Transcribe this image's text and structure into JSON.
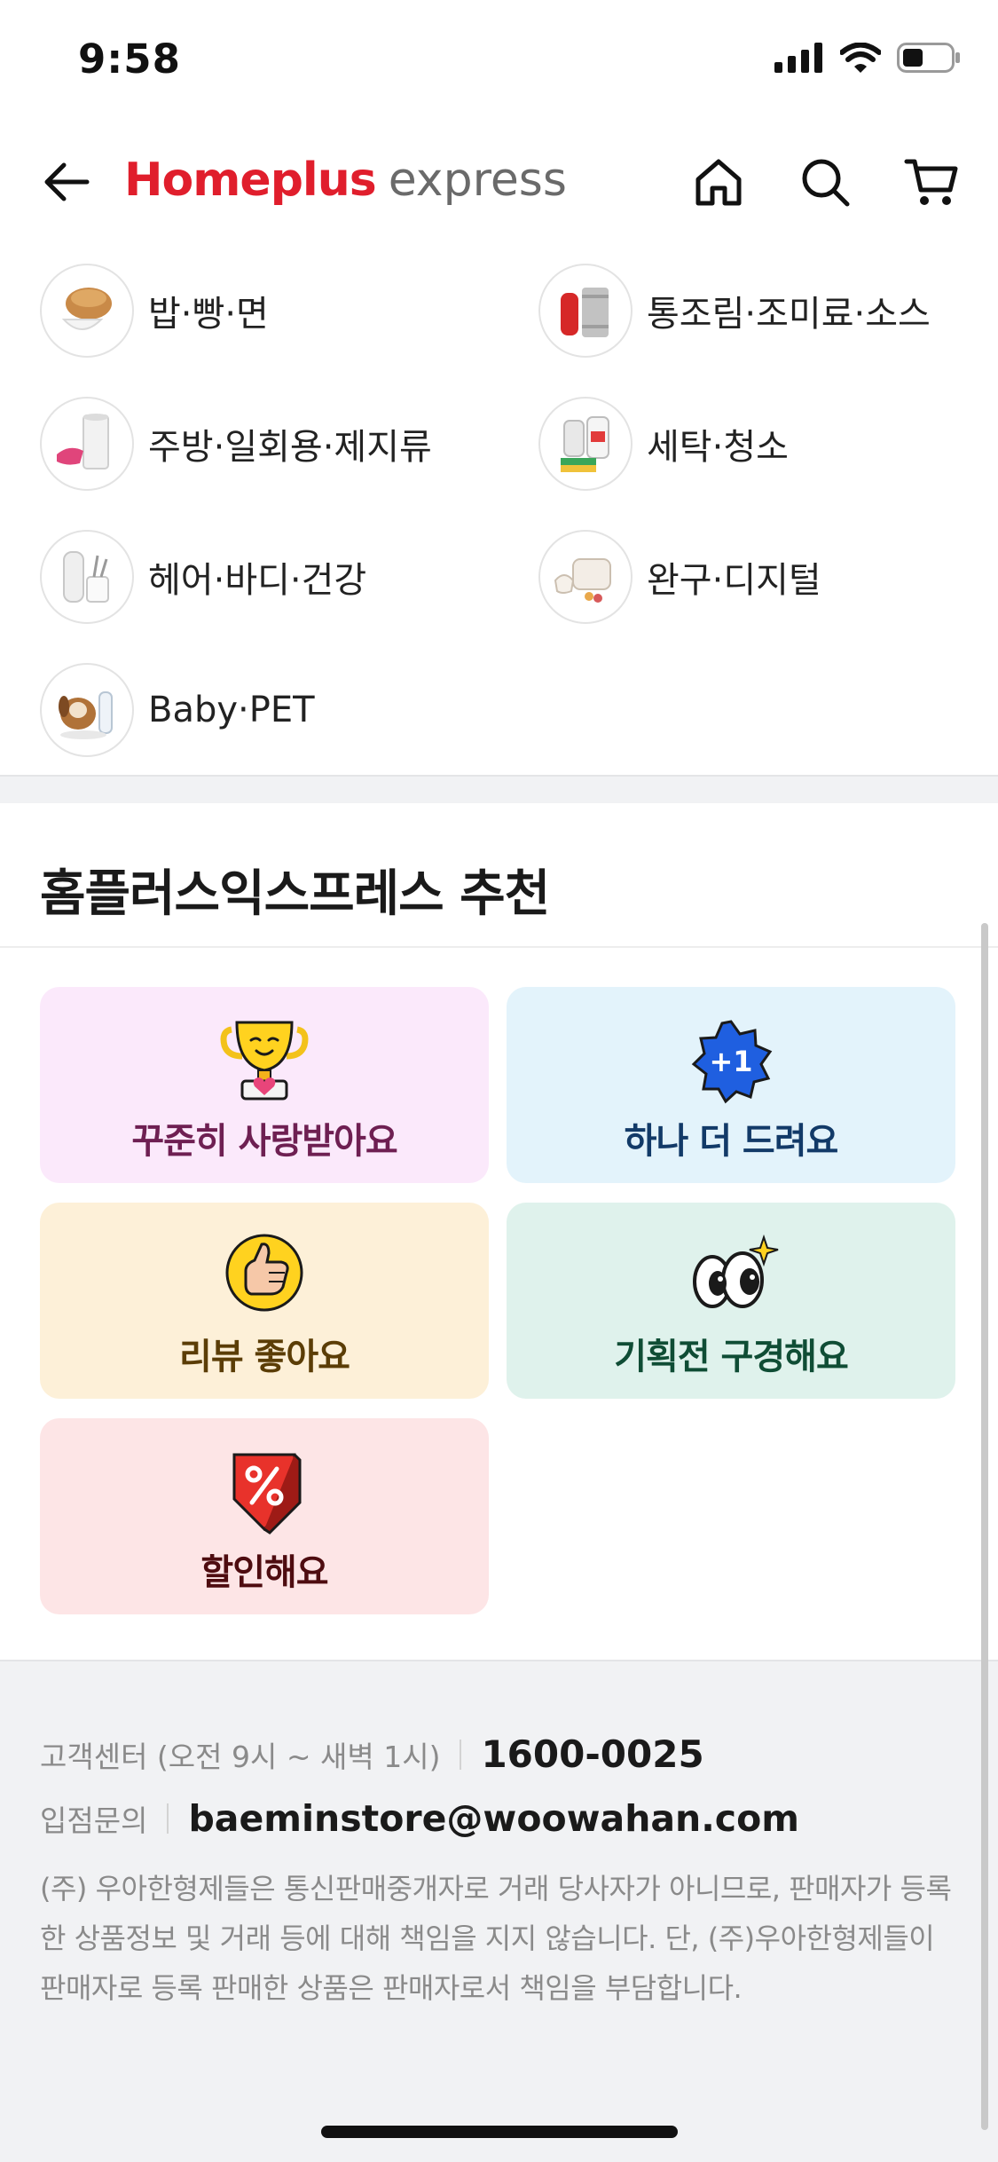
{
  "status_bar": {
    "time": "9:58"
  },
  "header": {
    "brand_main": "Homeplus",
    "brand_sub": "express",
    "icons": [
      "back-arrow-icon",
      "home-icon",
      "search-icon",
      "cart-icon"
    ]
  },
  "categories": [
    {
      "label": "밥·빵·면",
      "icon": "bread-icon"
    },
    {
      "label": "통조림·조미료·소스",
      "icon": "can-icon"
    },
    {
      "label": "주방·일회용·제지류",
      "icon": "paper-towel-icon"
    },
    {
      "label": "세탁·청소",
      "icon": "detergent-icon"
    },
    {
      "label": "헤어·바디·건강",
      "icon": "toiletries-icon"
    },
    {
      "label": "완구·디지털",
      "icon": "toaster-icon"
    },
    {
      "label": "Baby·PET",
      "icon": "puppy-icon"
    }
  ],
  "recommendations": {
    "title": "홈플러스익스프레스 추천",
    "cards": [
      {
        "label": "꾸준히 사랑받아요",
        "icon": "trophy-icon",
        "bg": "#fbe9fb",
        "color": "#6e1f52"
      },
      {
        "label": "하나 더 드려요",
        "icon": "plus-one-badge-icon",
        "bg": "#e3f3fb",
        "color": "#123a68"
      },
      {
        "label": "리뷰 좋아요",
        "icon": "thumbs-up-icon",
        "bg": "#fdf0d8",
        "color": "#5b3d06"
      },
      {
        "label": "기획전 구경해요",
        "icon": "eyes-icon",
        "bg": "#dff2ec",
        "color": "#0f4d35"
      },
      {
        "label": "할인해요",
        "icon": "discount-tag-icon",
        "bg": "#fde5e6",
        "color": "#4e0c10"
      }
    ]
  },
  "footer": {
    "cs_label": "고객센터 (오전 9시 ~ 새벽 1시)",
    "cs_phone": "1600-0025",
    "inquiry_label": "입점문의",
    "inquiry_email": "baeminstore@woowahan.com",
    "disclaimer": "(주) 우아한형제들은 통신판매중개자로 거래 당사자가 아니므로, 판매자가 등록한 상품정보 및 거래 등에 대해 책임을 지지 않습니다. 단, (주)우아한형제들이 판매자로 등록 판매한 상품은 판매자로서 책임을 부담합니다."
  }
}
